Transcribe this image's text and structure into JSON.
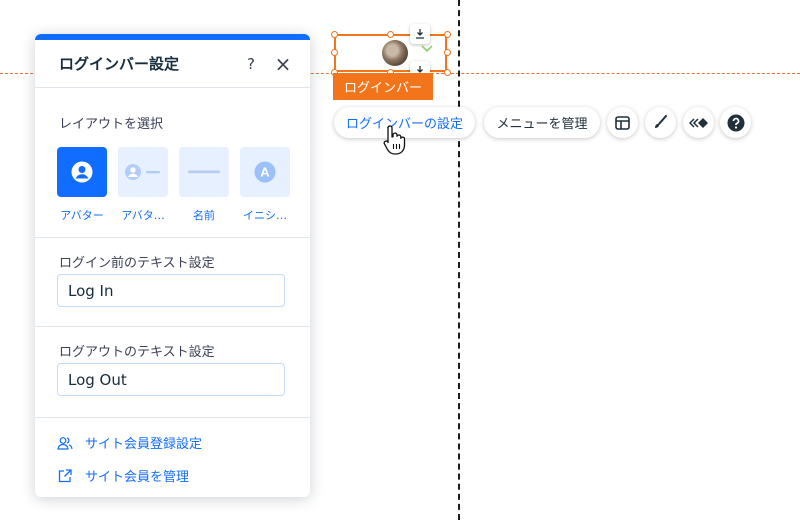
{
  "panel": {
    "title": "ログインバー設定",
    "help_icon": "?",
    "close_icon": "×",
    "layout_section": {
      "label": "レイアウトを選択",
      "options": [
        {
          "label": "アバター",
          "icon": "avatar-icon",
          "selected": true
        },
        {
          "label": "アバタ…",
          "icon": "avatar-text-icon",
          "selected": false
        },
        {
          "label": "名前",
          "icon": "name-line-icon",
          "selected": false
        },
        {
          "label": "イニシ…",
          "icon": "initials-icon",
          "glyph": "A",
          "selected": false
        }
      ]
    },
    "login_text": {
      "label": "ログイン前のテキスト設定",
      "value": "Log In"
    },
    "logout_text": {
      "label": "ログアウトのテキスト設定",
      "value": "Log Out"
    },
    "links": [
      {
        "label": "サイト会員登録設定",
        "icon": "members-icon"
      },
      {
        "label": "サイト会員を管理",
        "icon": "external-link-icon"
      }
    ]
  },
  "canvas": {
    "element_tag": "ログインバー",
    "toolbar": {
      "settings_label": "ログインバーの設定",
      "menu_label": "メニューを管理",
      "icons": [
        "layout-icon",
        "design-brush-icon",
        "animation-icon",
        "help-icon"
      ]
    }
  },
  "colors": {
    "accent": "#116dff",
    "selection": "#f2751c",
    "option_bg": "#e7f0ff"
  }
}
